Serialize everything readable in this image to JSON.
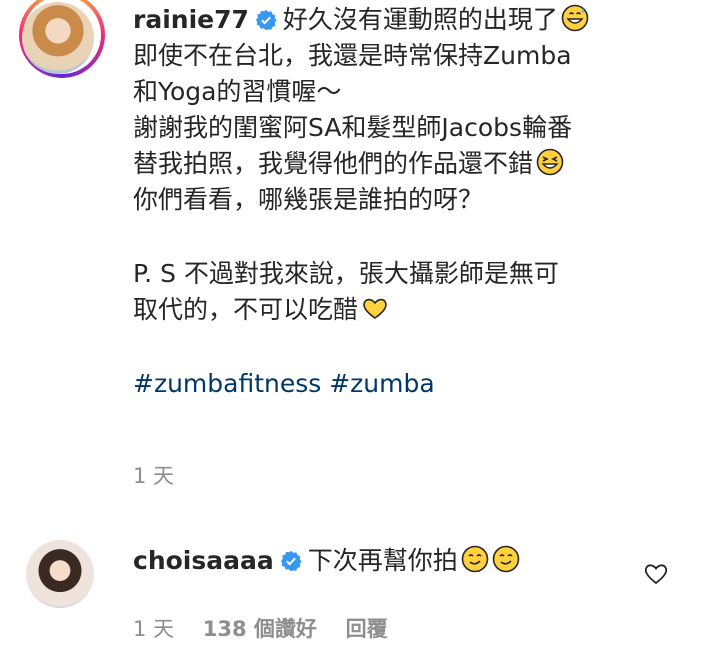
{
  "post": {
    "username": "rainie77",
    "lines": [
      "好久沒有運動照的出現了",
      "即使不在台北，我還是時常保持Zumba",
      "和Yoga的習慣喔～",
      "謝謝我的閨蜜阿SA和髮型師Jacobs輪番",
      "替我拍照，我覺得他們的作品還不錯",
      "你們看看，哪幾張是誰拍的呀？",
      "P. S 不過對我來說，張大攝影師是無可",
      "取代的，不可以吃醋"
    ],
    "hashtags": [
      "#zumbafitness",
      "#zumba"
    ],
    "time": "1 天"
  },
  "reply": {
    "username": "choisaaaa",
    "text": "下次再幫你拍",
    "time": "1 天",
    "likes": "138 個讚好",
    "reply_label": "回覆"
  },
  "colors": {
    "text": "#262626",
    "muted": "#8e8e8e",
    "hashtag": "#00376b",
    "verified": "#3897f0"
  }
}
